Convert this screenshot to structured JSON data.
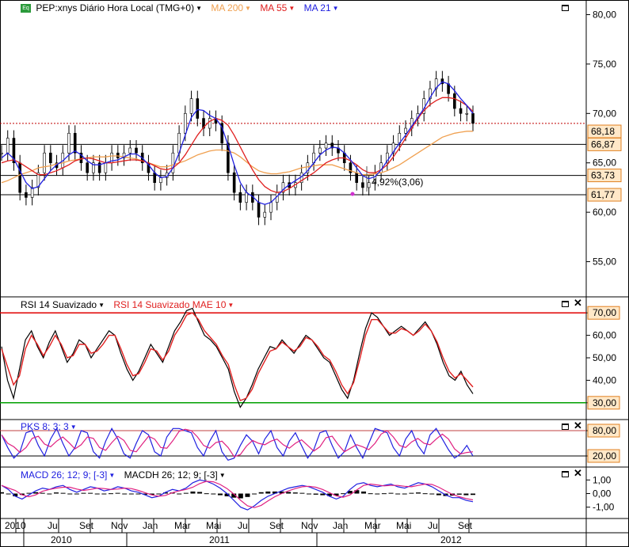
{
  "panels": {
    "price": {
      "symbol_label": "PEP:xnys Diário Hora Local (TMG+0)",
      "ma200_label": "MA 200",
      "ma55_label": "MA 55",
      "ma21_label": "MA 21",
      "annotation": "4,92%(3,06)"
    },
    "rsi": {
      "label": "RSI 14 Suavizado",
      "signal_label": "RSI 14 Suavizado MAE 10"
    },
    "stoch": {
      "label": "PKS 8; 3; 3"
    },
    "macd": {
      "label": "MACD 26; 12; 9; [-3]",
      "hist_label": "MACDH 26; 12; 9; [-3]"
    }
  },
  "colors": {
    "price": "#000000",
    "ma200": "#f0a050",
    "ma55": "#e02020",
    "ma21": "#2020e0",
    "rsi_line": "#000000",
    "rsi_signal": "#e02020",
    "stoch_k": "#2020e0",
    "stoch_d": "#e02080",
    "upper_level": "#e00000",
    "lower_level": "#00a000",
    "dotted_level": "#c00000",
    "price_tag_fill": "#ffe8c8",
    "price_tag_border": "#e08020"
  },
  "chart_data": [
    {
      "type": "line",
      "name": "price",
      "y_ticks": [
        "80,00",
        "75,00",
        "70,00",
        "65,00",
        "60,00",
        "55,00"
      ],
      "y_tick_values": [
        80,
        75,
        70,
        65,
        60,
        55
      ],
      "ylim": [
        52,
        81
      ],
      "series": [
        {
          "name": "PEP",
          "values": [
            66,
            67.5,
            65,
            62,
            61.5,
            62.5,
            64,
            66,
            65,
            64.5,
            66,
            68,
            66,
            65,
            64,
            65,
            64,
            65,
            66,
            65.5,
            66,
            66.5,
            66,
            65,
            64,
            63,
            63.5,
            64,
            66,
            68,
            70,
            71.5,
            69.5,
            68.5,
            69.5,
            69,
            67,
            64,
            62,
            61,
            62,
            61,
            59.5,
            60,
            61,
            62,
            63,
            62.5,
            63,
            64,
            65,
            66,
            66.5,
            67,
            66.5,
            66,
            65,
            64,
            63,
            62.5,
            63,
            64,
            65,
            66,
            67,
            68,
            68.5,
            69.5,
            70,
            71.5,
            72.5,
            73.5,
            73,
            72,
            70.5,
            70,
            70,
            69
          ]
        },
        {
          "name": "MA 200",
          "values": [
            63,
            63.2,
            63.5,
            63.8,
            64,
            64.2,
            64.5,
            64.6,
            64.7,
            64.9,
            65,
            65.2,
            65.3,
            65.4,
            65.5,
            65.6,
            65.6,
            65.6,
            65.7,
            65.7,
            65.6,
            65.5,
            65.4,
            65.2,
            65,
            64.8,
            64.6,
            64.6,
            64.8,
            65,
            65.2,
            65.5,
            65.8,
            66,
            66.2,
            66.3,
            66.3,
            66.2,
            66,
            65.6,
            65.1,
            64.6,
            64.2,
            64,
            63.9,
            63.9,
            64,
            64.1,
            64.3,
            64.5,
            64.6,
            64.7,
            64.8,
            64.8,
            64.8,
            64.6,
            64.4,
            64.2,
            64,
            63.8,
            63.8,
            63.9,
            64,
            64.2,
            64.5,
            64.8,
            65.2,
            65.6,
            66,
            66.4,
            66.8,
            67.2,
            67.6,
            67.8,
            68,
            68.1,
            68.2,
            68.2
          ]
        },
        {
          "name": "MA 55",
          "values": [
            65,
            65.2,
            65.3,
            65,
            64.6,
            64.2,
            63.8,
            63.8,
            64,
            64.2,
            64.5,
            64.8,
            65.2,
            65.4,
            65.5,
            65.4,
            65.2,
            65,
            65,
            65.1,
            65.2,
            65.3,
            65.3,
            65.2,
            65,
            64.7,
            64.4,
            64.3,
            64.5,
            65,
            65.8,
            66.8,
            67.8,
            68.6,
            69.2,
            69.5,
            69.3,
            68.8,
            67.8,
            66.6,
            65.4,
            64.3,
            63.3,
            62.6,
            62.2,
            62,
            62.1,
            62.4,
            62.8,
            63.2,
            63.6,
            64,
            64.5,
            65,
            65.3,
            65.5,
            65.5,
            65.2,
            64.8,
            64.3,
            64,
            64,
            64.3,
            64.8,
            65.6,
            66.5,
            67.5,
            68.5,
            69.5,
            70.3,
            70.9,
            71.3,
            71.6,
            71.6,
            71.5,
            71.2,
            70.8,
            70.2
          ]
        },
        {
          "name": "MA 21",
          "values": [
            65.5,
            66,
            65.4,
            64.2,
            63,
            62.4,
            62.6,
            63.4,
            64.2,
            64.8,
            65.2,
            65.8,
            66.2,
            65.8,
            65.2,
            64.8,
            64.8,
            65,
            65.2,
            65.3,
            65.6,
            65.9,
            65.9,
            65.5,
            64.8,
            64,
            63.5,
            63.6,
            64.5,
            66,
            67.8,
            69.6,
            70.4,
            70.3,
            69.8,
            69.5,
            68.6,
            66.8,
            64.8,
            63,
            62,
            61.6,
            61,
            60.8,
            61,
            61.6,
            62.3,
            62.8,
            63.2,
            63.6,
            64.2,
            65,
            65.8,
            66.3,
            66.6,
            66.5,
            66,
            65.3,
            64.5,
            63.7,
            63.4,
            63.6,
            64.3,
            65.2,
            66.1,
            67,
            67.8,
            68.7,
            69.6,
            70.5,
            71.6,
            72.6,
            73.2,
            73,
            72.3,
            71.5,
            70.8,
            70
          ]
        }
      ],
      "levels": [
        68.99,
        66.87,
        63.73,
        61.77
      ],
      "price_tags": [
        "68,18",
        "66,87",
        "63,73",
        "61,77"
      ],
      "hidden_tag": "68,99"
    },
    {
      "type": "line",
      "name": "rsi",
      "y_ticks": [
        "70,00",
        "60,00",
        "50,00",
        "40,00",
        "30,00"
      ],
      "y_tick_values": [
        70,
        60,
        50,
        40,
        30
      ],
      "highlighted_ticks": [
        "70,00",
        "30,00"
      ],
      "ylim": [
        25,
        75
      ],
      "levels": [
        70,
        30
      ],
      "series": [
        {
          "name": "RSI 14 Suavizado",
          "values": [
            55,
            40,
            32,
            45,
            58,
            62,
            55,
            50,
            57,
            62,
            55,
            48,
            52,
            58,
            56,
            50,
            54,
            58,
            62,
            60,
            52,
            45,
            40,
            44,
            50,
            56,
            52,
            48,
            55,
            62,
            66,
            71,
            72,
            66,
            60,
            58,
            55,
            50,
            45,
            35,
            28,
            32,
            38,
            45,
            50,
            55,
            54,
            58,
            55,
            52,
            56,
            60,
            58,
            54,
            50,
            48,
            42,
            36,
            32,
            40,
            52,
            63,
            70,
            68,
            64,
            60,
            62,
            64,
            62,
            60,
            63,
            66,
            62,
            56,
            48,
            42,
            40,
            44,
            38,
            34
          ]
        },
        {
          "name": "RSI 14 Suavizado MAE 10",
          "values": [
            54,
            46,
            38,
            42,
            54,
            60,
            56,
            51,
            55,
            60,
            56,
            50,
            51,
            56,
            56,
            52,
            53,
            56,
            60,
            60,
            54,
            47,
            42,
            43,
            48,
            54,
            53,
            49,
            53,
            60,
            64,
            69,
            70,
            67,
            62,
            59,
            56,
            51,
            47,
            38,
            31,
            32,
            36,
            43,
            48,
            53,
            54,
            57,
            55,
            53,
            55,
            59,
            58,
            55,
            51,
            49,
            44,
            38,
            34,
            39,
            49,
            60,
            67,
            67,
            64,
            61,
            61,
            63,
            62,
            60,
            62,
            65,
            62,
            57,
            50,
            44,
            41,
            43,
            40,
            37
          ]
        }
      ]
    },
    {
      "type": "line",
      "name": "stochastic",
      "y_ticks": [
        "80,00",
        "20,00"
      ],
      "y_tick_values": [
        80,
        20
      ],
      "highlighted_ticks": [
        "80,00",
        "20,00"
      ],
      "ylim": [
        5,
        95
      ],
      "levels": [
        80,
        20
      ],
      "series": [
        {
          "name": "PKS 8; 3; 3",
          "values": [
            70,
            40,
            15,
            30,
            75,
            80,
            45,
            20,
            60,
            85,
            50,
            20,
            40,
            80,
            75,
            30,
            15,
            55,
            85,
            60,
            25,
            15,
            50,
            80,
            70,
            30,
            20,
            65,
            85,
            85,
            80,
            75,
            40,
            20,
            55,
            80,
            30,
            10,
            15,
            45,
            70,
            55,
            25,
            60,
            80,
            40,
            20,
            55,
            75,
            45,
            15,
            35,
            75,
            80,
            45,
            15,
            30,
            70,
            40,
            15,
            50,
            85,
            80,
            75,
            40,
            20,
            60,
            80,
            45,
            25,
            70,
            85,
            60,
            35,
            15,
            25,
            45,
            20
          ]
        }
      ]
    },
    {
      "type": "line",
      "name": "macd",
      "y_ticks": [
        "1,00",
        "0,00",
        "-1,00"
      ],
      "y_tick_values": [
        1,
        0,
        -1
      ],
      "ylim": [
        -1.6,
        1.6
      ],
      "series": [
        {
          "name": "MACD 26; 12; 9; [-3]",
          "values": [
            0.6,
            0.3,
            -0.2,
            -0.4,
            -0.1,
            0.2,
            0.4,
            0.3,
            0.5,
            0.6,
            0.3,
            0.1,
            0.3,
            0.5,
            0.4,
            0.2,
            0.3,
            0.5,
            0.4,
            0.2,
            0.1,
            -0.1,
            -0.3,
            -0.2,
            0.1,
            0.3,
            0.2,
            0.4,
            0.8,
            1.0,
            0.9,
            0.7,
            0.4,
            0.0,
            -0.5,
            -1.0,
            -1.2,
            -0.9,
            -0.5,
            -0.2,
            0.0,
            0.2,
            0.4,
            0.5,
            0.6,
            0.5,
            0.3,
            0.1,
            -0.2,
            -0.4,
            -0.2,
            0.3,
            0.7,
            0.8,
            0.6,
            0.5,
            0.6,
            0.7,
            0.5,
            0.4,
            0.6,
            0.8,
            0.7,
            0.5,
            0.2,
            -0.1,
            -0.3,
            -0.3,
            -0.5,
            -0.6
          ]
        },
        {
          "name": "MACDH 26; 12; 9; [-3]",
          "values": [
            0.1,
            -0.05,
            -0.2,
            -0.1,
            0.05,
            0.1,
            0.05,
            0,
            0.08,
            0.05,
            -0.05,
            -0.05,
            0.05,
            0.05,
            0,
            -0.05,
            0.02,
            0.05,
            0,
            -0.05,
            -0.05,
            -0.08,
            -0.1,
            -0.02,
            0.08,
            0.08,
            0,
            0.05,
            0.15,
            0.12,
            0.02,
            -0.05,
            -0.12,
            -0.2,
            -0.3,
            -0.35,
            -0.25,
            -0.05,
            0.1,
            0.15,
            0.15,
            0.15,
            0.12,
            0.08,
            0.05,
            -0.02,
            -0.08,
            -0.12,
            -0.18,
            -0.15,
            0.02,
            0.2,
            0.25,
            0.15,
            0.02,
            -0.02,
            0.02,
            0.05,
            -0.03,
            -0.02,
            0.05,
            0.08,
            0.02,
            -0.05,
            -0.12,
            -0.18,
            -0.15,
            -0.08,
            -0.12,
            -0.1
          ]
        }
      ]
    }
  ],
  "x_axis": {
    "months": [
      "2010",
      "Jul",
      "Set",
      "Nov",
      "Jan",
      "Mar",
      "Mai",
      "Jul",
      "Set",
      "Nov",
      "Jan",
      "Mar",
      "Mai",
      "Jul",
      "Set"
    ],
    "years": [
      "2010",
      "2011",
      "2012"
    ]
  }
}
